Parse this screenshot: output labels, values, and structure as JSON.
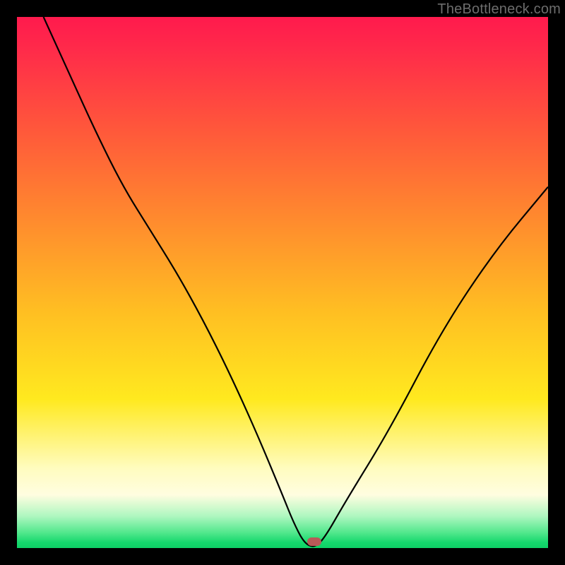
{
  "watermark": {
    "text": "TheBottleneck.com"
  },
  "marker": {
    "x_pct": 56,
    "y_pct": 98.8,
    "color": "#b85a58"
  },
  "chart_data": {
    "type": "line",
    "title": "",
    "xlabel": "",
    "ylabel": "",
    "xlim": [
      0,
      100
    ],
    "ylim": [
      0,
      100
    ],
    "grid": false,
    "legend": false,
    "note": "V-shaped bottleneck curve over vertical red→green gradient; minimum (optimal point) marked by pill at x≈56.",
    "series": [
      {
        "name": "bottleneck-curve",
        "x": [
          5,
          10,
          15,
          20,
          25,
          30,
          35,
          40,
          45,
          50,
          52,
          54,
          56,
          58,
          62,
          70,
          80,
          90,
          100
        ],
        "y": [
          100,
          89,
          78,
          68,
          60,
          52,
          43,
          33,
          22,
          10,
          5,
          1,
          0,
          2,
          9,
          22,
          41,
          56,
          68
        ]
      }
    ],
    "background_gradient": {
      "direction": "top-to-bottom",
      "stops": [
        {
          "pct": 0,
          "color": "#ff1a4d"
        },
        {
          "pct": 22,
          "color": "#ff5a3a"
        },
        {
          "pct": 56,
          "color": "#ffc022"
        },
        {
          "pct": 85,
          "color": "#fffcbf"
        },
        {
          "pct": 97,
          "color": "#55e88e"
        },
        {
          "pct": 100,
          "color": "#0fd066"
        }
      ]
    }
  }
}
